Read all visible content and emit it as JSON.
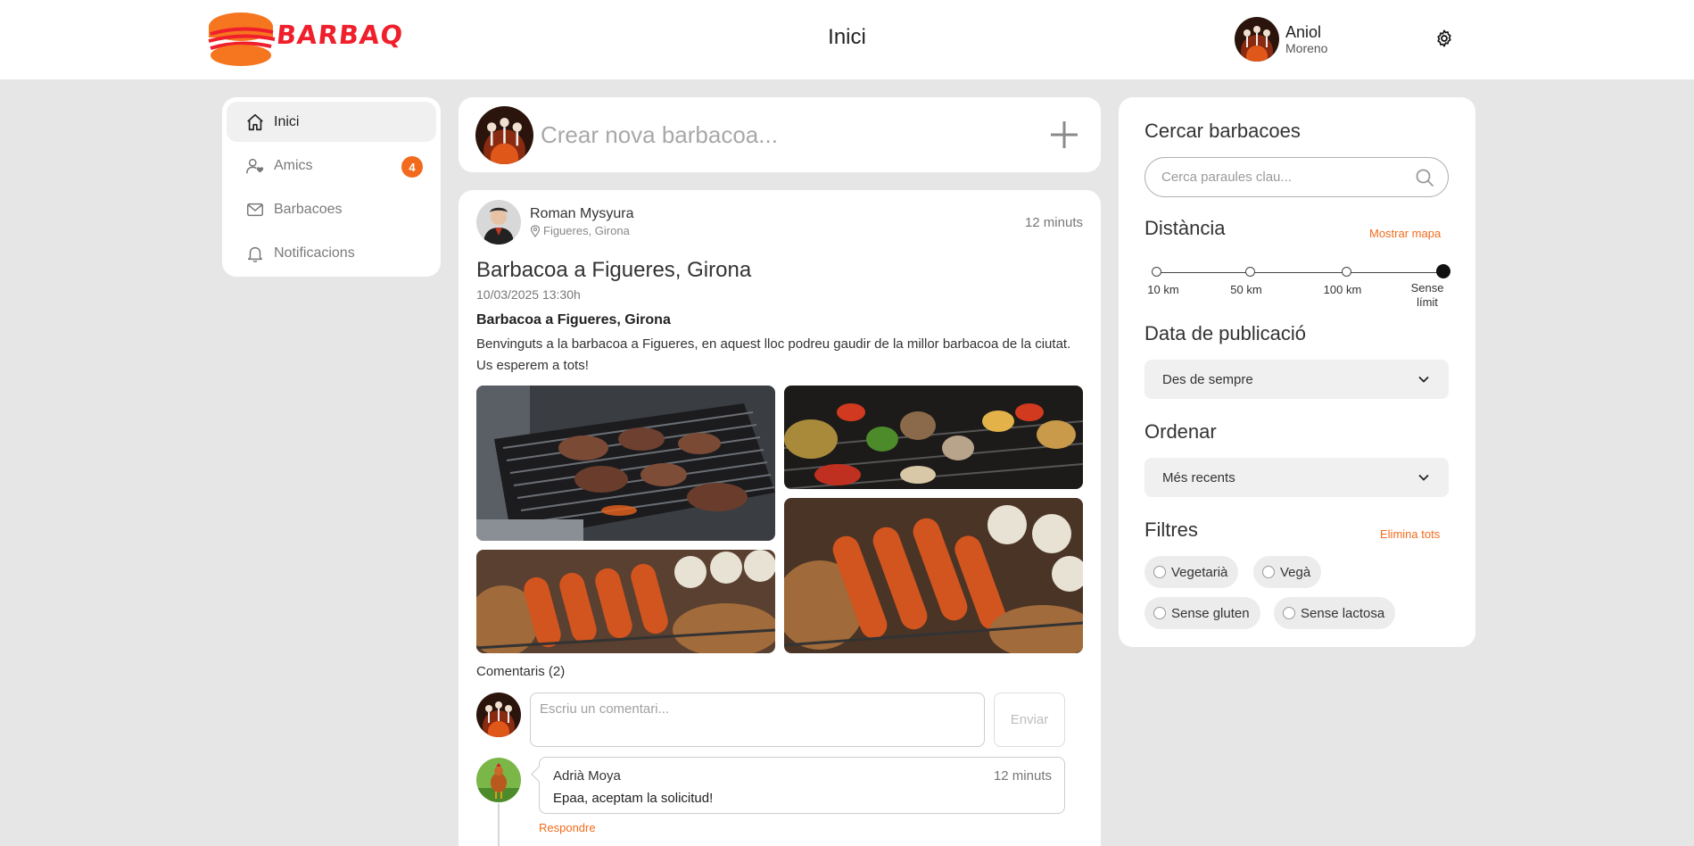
{
  "header": {
    "logo_text": "BARBAQ",
    "title": "Inici",
    "user": {
      "first_name": "Aniol",
      "last_name": "Moreno"
    }
  },
  "sidebar": {
    "items": [
      {
        "label": "Inici",
        "icon": "home-icon",
        "active": true
      },
      {
        "label": "Amics",
        "icon": "user-heart-icon",
        "badge": "4"
      },
      {
        "label": "Barbacoes",
        "icon": "mail-icon"
      },
      {
        "label": "Notificacions",
        "icon": "bell-icon"
      }
    ]
  },
  "create": {
    "placeholder": "Crear nova barbacoa..."
  },
  "post": {
    "author": "Roman Mysyura",
    "location": "Figueres, Girona",
    "time_ago": "12 minuts",
    "title": "Barbacoa a Figueres, Girona",
    "date": "10/03/2025 13:30h",
    "subtitle": "Barbacoa a Figueres, Girona",
    "body": "Benvinguts a la barbacoa a Figueres, en aquest lloc podreu gaudir de la millor barbacoa de la ciutat. Us esperem a tots!",
    "comments_label": "Comentaris (2)",
    "comment_placeholder": "Escriu un comentari...",
    "send_label": "Enviar",
    "comments": [
      {
        "author": "Adrià Moya",
        "time_ago": "12 minuts",
        "text": "Epaa, aceptam la solicitud!",
        "reply_label": "Respondre"
      }
    ]
  },
  "filters": {
    "search_title": "Cercar barbacoes",
    "search_placeholder": "Cerca paraules clau...",
    "distance_title": "Distància",
    "show_map": "Mostrar mapa",
    "distance_options": [
      "10 km",
      "50 km",
      "100 km",
      "Sense límit"
    ],
    "distance_selected_index": 3,
    "date_title": "Data de publicació",
    "date_value": "Des de sempre",
    "sort_title": "Ordenar",
    "sort_value": "Més recents",
    "filters_title": "Filtres",
    "clear_all": "Elimina tots",
    "chips": [
      "Vegetarià",
      "Vegà",
      "Sense gluten",
      "Sense lactosa"
    ]
  },
  "colors": {
    "accent": "#f26b1d",
    "logo_red": "#ef1f2b",
    "background": "#e6e6e6"
  }
}
